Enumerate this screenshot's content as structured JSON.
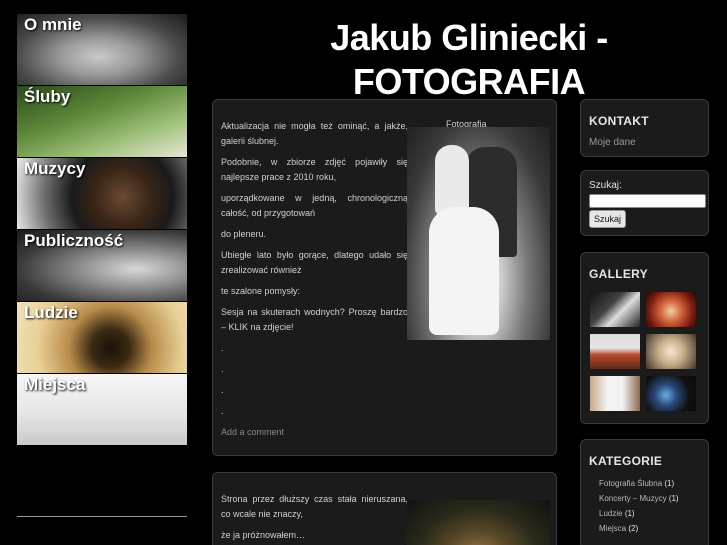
{
  "header": {
    "title_line1": "Jakub Gliniecki -",
    "title_line2": "FOTOGRAFIA"
  },
  "nav": [
    {
      "label": "O mnie"
    },
    {
      "label": "Śluby"
    },
    {
      "label": "Muzycy"
    },
    {
      "label": "Publiczność"
    },
    {
      "label": "Ludzie"
    },
    {
      "label": "Miejsca"
    }
  ],
  "post1": {
    "paragraphs": [
      "Aktualizacja nie mogła też ominąć, a jakże, galerii ślubnej.",
      "Podobnie, w zbiorze zdjęć pojawiły się najlepsze prace z 2010 roku,",
      "uporządkowane w jedną, chronologiczną całość, od przygotowań",
      "do pleneru.",
      "Ubiegłe lato było gorące, dlatego udało się zrealizować również",
      "te szalone pomysły:",
      "Sesja na skuterach wodnych? Proszę bardzo – KLIK na zdjęcie!",
      ".",
      ".",
      ".",
      "."
    ],
    "photo_caption": "Fotografia",
    "comment_link": "Add a comment"
  },
  "post2": {
    "paragraphs": [
      "Strona przez dłuższy czas stała nieruszana, co wcale nie znaczy,",
      "że ja próżnowałem…"
    ]
  },
  "sidebar": {
    "kontakt": {
      "title": "KONTAKT",
      "link": "Moje dane"
    },
    "search": {
      "label": "Szukaj:",
      "button": "Szukaj",
      "value": ""
    },
    "gallery": {
      "title": "GALLERY"
    },
    "kategorie": {
      "title": "KATEGORIE",
      "items": [
        {
          "name": "Fotografia Ślubna",
          "count": "(1)"
        },
        {
          "name": "Koncerty – Muzycy",
          "count": "(1)"
        },
        {
          "name": "Ludzie",
          "count": "(1)"
        },
        {
          "name": "Miejsca",
          "count": "(2)"
        }
      ]
    }
  }
}
